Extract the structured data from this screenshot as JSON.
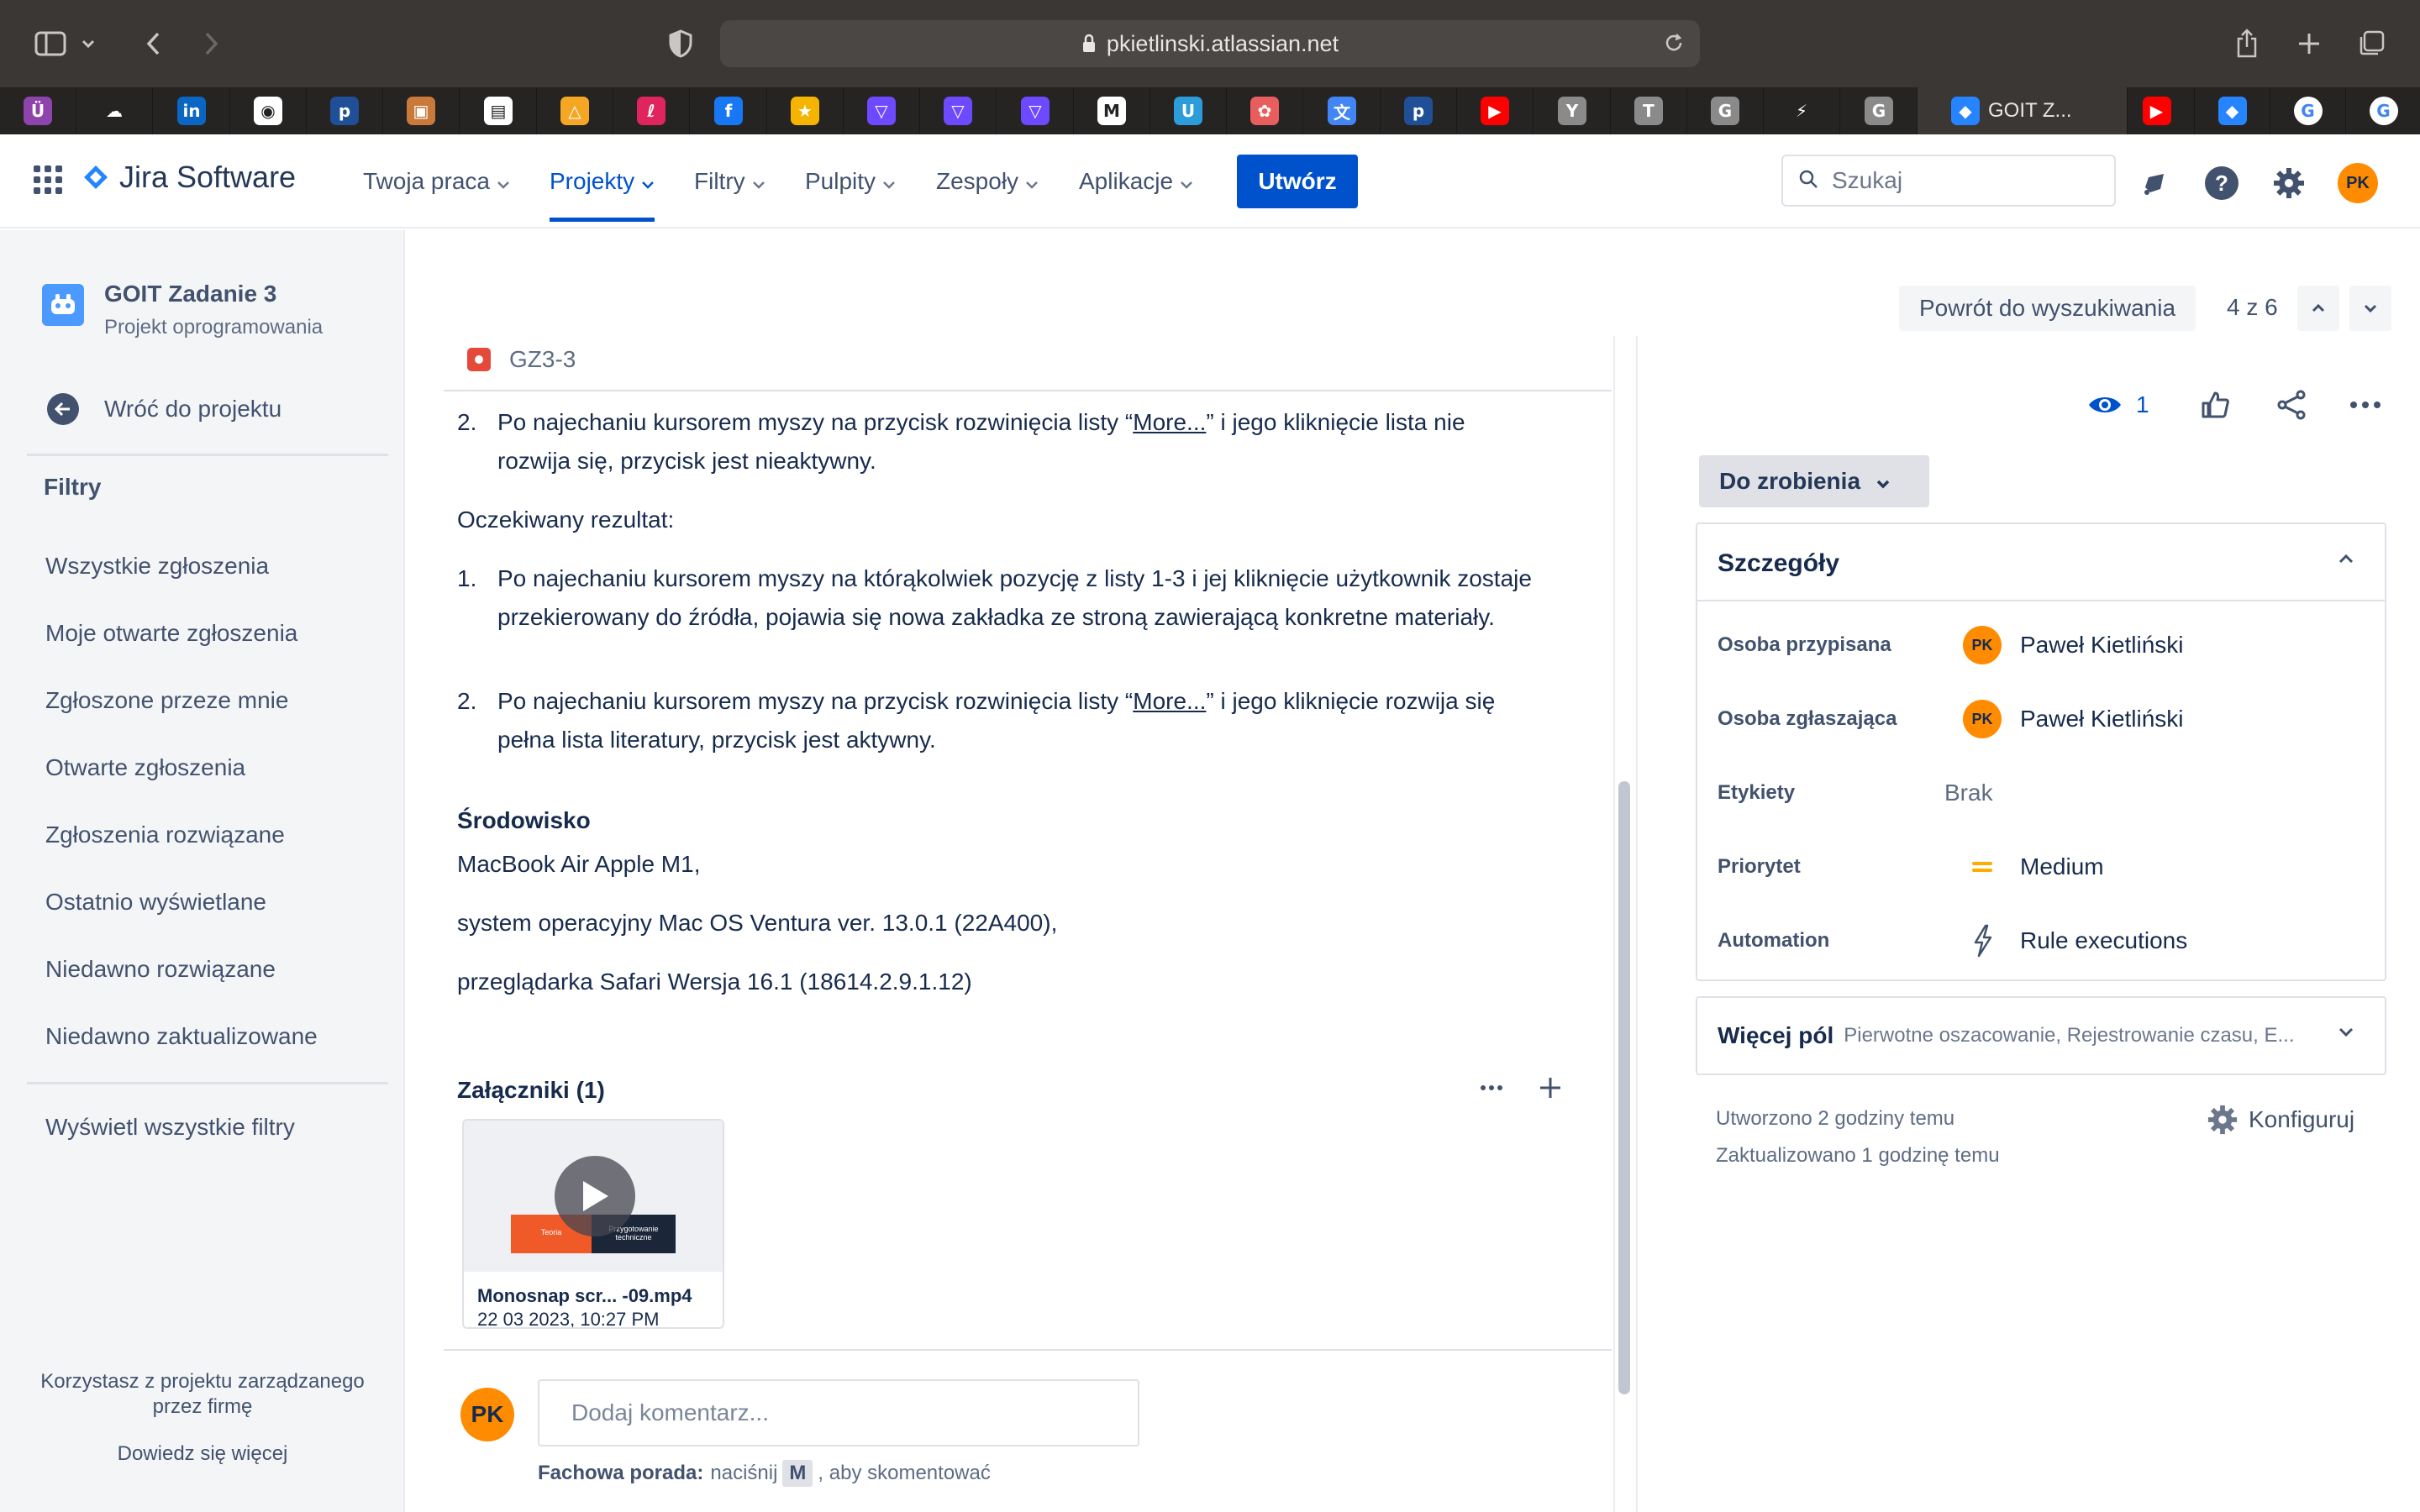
{
  "browser": {
    "url": "pkietlinski.atlassian.net",
    "active_tab_title": "GOIT Z...",
    "favorites": [
      {
        "icon": "u-app-icon",
        "glyph": "Ü",
        "color": "#8e44ad"
      },
      {
        "icon": "cloud-icon",
        "glyph": "☁",
        "color": "#262423"
      },
      {
        "icon": "linkedin-icon",
        "glyph": "in",
        "color": "#0a66c2"
      },
      {
        "icon": "github-icon",
        "glyph": "◉",
        "color": "#ffffff"
      },
      {
        "icon": "p-app-icon",
        "glyph": "p",
        "color": "#1f4f96"
      },
      {
        "icon": "photo-icon",
        "glyph": "▣",
        "color": "#c97a3a"
      },
      {
        "icon": "notebook-icon",
        "glyph": "▤",
        "color": "#ffffff"
      },
      {
        "icon": "warning-triangle-icon",
        "glyph": "△",
        "color": "#f5a623"
      },
      {
        "icon": "pink-app-icon",
        "glyph": "ℓ",
        "color": "#e0245e"
      },
      {
        "icon": "facebook-icon",
        "glyph": "f",
        "color": "#1877f2"
      },
      {
        "icon": "star-icon",
        "glyph": "★",
        "color": "#f5b400"
      },
      {
        "icon": "proton-vpn-icon",
        "glyph": "▽",
        "color": "#6d4aff"
      },
      {
        "icon": "proton-vpn-icon",
        "glyph": "▽",
        "color": "#6d4aff"
      },
      {
        "icon": "proton-vpn-icon",
        "glyph": "▽",
        "color": "#6d4aff"
      },
      {
        "icon": "m-logo-icon",
        "glyph": "M",
        "color": "#ffffff"
      },
      {
        "icon": "u-circle-icon",
        "glyph": "U",
        "color": "#2d9cdb"
      },
      {
        "icon": "openai-icon",
        "glyph": "✿",
        "color": "#e85d5d"
      },
      {
        "icon": "translate-icon",
        "glyph": "文",
        "color": "#4285f4"
      },
      {
        "icon": "p-app-icon",
        "glyph": "p",
        "color": "#1f4f96"
      },
      {
        "icon": "youtube-icon",
        "glyph": "▶",
        "color": "#ff0000"
      },
      {
        "icon": "y-icon",
        "glyph": "Y",
        "color": "#8a8a8a"
      },
      {
        "icon": "t-icon",
        "glyph": "T",
        "color": "#8a8a8a"
      },
      {
        "icon": "g-icon",
        "glyph": "G",
        "color": "#8a8a8a"
      },
      {
        "icon": "bolt-icon",
        "glyph": "⚡",
        "color": "#262423"
      },
      {
        "icon": "g-icon",
        "glyph": "G",
        "color": "#8a8a8a"
      }
    ],
    "favorites_right": [
      {
        "icon": "youtube-icon",
        "glyph": "▶",
        "color": "#ff0000"
      },
      {
        "icon": "jira-icon",
        "glyph": "◆",
        "color": "#2684ff"
      },
      {
        "icon": "google-icon",
        "glyph": "G",
        "color": "#ffffff"
      },
      {
        "icon": "google-icon",
        "glyph": "G",
        "color": "#ffffff"
      }
    ]
  },
  "topnav": {
    "product": "Jira Software",
    "items": [
      "Twoja praca",
      "Projekty",
      "Filtry",
      "Pulpity",
      "Zespoły",
      "Aplikacje"
    ],
    "active_item": "Projekty",
    "create_label": "Utwórz",
    "search_placeholder": "Szukaj",
    "user_initials": "PK",
    "accent_color": "#0052cc"
  },
  "sidebar": {
    "project_name": "GOIT Zadanie 3",
    "project_type": "Projekt oprogramowania",
    "back_label": "Wróć do projektu",
    "filters_heading": "Filtry",
    "filters": [
      "Wszystkie zgłoszenia",
      "Moje otwarte zgłoszenia",
      "Zgłoszone przeze mnie",
      "Otwarte zgłoszenia",
      "Zgłoszenia rozwiązane",
      "Ostatnio wyświetlane",
      "Niedawno rozwiązane",
      "Niedawno zaktualizowane"
    ],
    "all_filters_label": "Wyświetl wszystkie filtry",
    "footer_text_line1": "Korzystasz z projektu zarządzanego",
    "footer_text_line2": "przez firmę",
    "footer_link": "Dowiedz się więcej"
  },
  "issue": {
    "key": "GZ3-3",
    "steps_item2_num": "2.",
    "steps_item2_pre": "Po najechaniu kursorem myszy na przycisk rozwinięcia listy “",
    "steps_item2_link": "More...",
    "steps_item2_post": "” i jego kliknięcie lista nie rozwija się, przycisk jest nieaktywny.",
    "expected_heading": "Oczekiwany rezultat:",
    "expected_item1_num": "1.",
    "expected_item1": "Po najechaniu kursorem myszy na którąkolwiek pozycję z listy 1-3 i jej kliknięcie użytkownik zostaje przekierowany do źródła, pojawia się nowa zakładka ze stroną zawierającą konkretne materiały.",
    "expected_item2_num": "2.",
    "expected_item2_pre": "Po najechaniu kursorem myszy na przycisk rozwinięcia listy “",
    "expected_item2_link": "More...",
    "expected_item2_post": "” i jego kliknięcie rozwija się pełna lista literatury, przycisk jest aktywny.",
    "environment_heading": "Środowisko",
    "environment_lines": [
      "MacBook Air Apple M1,",
      "system operacyjny Mac OS Ventura ver. 13.0.1 (22A400),",
      "przeglądarka Safari Wersja 16.1 (18614.2.9.1.12)"
    ],
    "attachments_heading": "Załączniki (1)",
    "attachment": {
      "filename": "Monosnap scr...  -09.mp4",
      "date": "22 03 2023, 10:27 PM",
      "thumb_text_left": "Teoria",
      "thumb_text_right": "Przygotowanie techniczne"
    },
    "comment_initials": "PK",
    "comment_placeholder": "Dodaj komentarz...",
    "tip_bold": "Fachowa porada:",
    "tip_pre": "naciśnij",
    "tip_key": "M",
    "tip_post": ", aby skomentować"
  },
  "panel": {
    "back_to_search": "Powrót do wyszukiwania",
    "pager": "4 z 6",
    "watchers_count": "1",
    "status": "Do zrobienia",
    "details_heading": "Szczegóły",
    "fields": {
      "assignee_label": "Osoba przypisana",
      "assignee_initials": "PK",
      "assignee_name": "Paweł Kietliński",
      "reporter_label": "Osoba zgłaszająca",
      "reporter_initials": "PK",
      "reporter_name": "Paweł Kietliński",
      "labels_label": "Etykiety",
      "labels_value": "Brak",
      "priority_label": "Priorytet",
      "priority_value": "Medium",
      "priority_color": "#ffab00",
      "automation_label": "Automation",
      "automation_value": "Rule executions"
    },
    "more_fields_label": "Więcej pól",
    "more_fields_summary": "Pierwotne oszacowanie, Rejestrowanie czasu, E...",
    "created": "Utworzono 2 godziny temu",
    "updated": "Zaktualizowano 1 godzinę temu",
    "configure_label": "Konfiguruj"
  }
}
